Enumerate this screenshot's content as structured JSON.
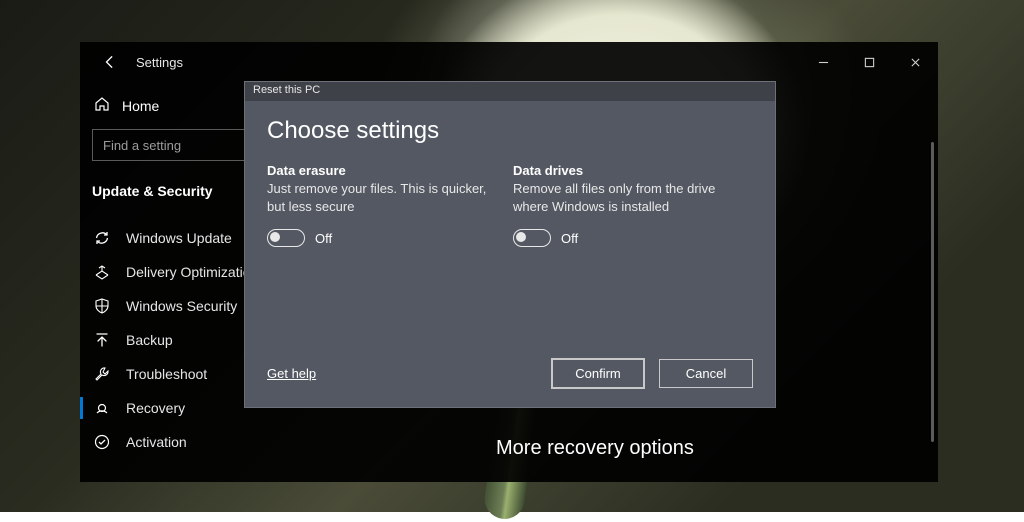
{
  "window": {
    "title": "Settings"
  },
  "sidebar": {
    "home": "Home",
    "search_placeholder": "Find a setting",
    "section_heading": "Update & Security",
    "items": [
      {
        "label": "Windows Update"
      },
      {
        "label": "Delivery Optimization"
      },
      {
        "label": "Windows Security"
      },
      {
        "label": "Backup"
      },
      {
        "label": "Troubleshoot"
      },
      {
        "label": "Recovery"
      },
      {
        "label": "Activation"
      }
    ]
  },
  "main": {
    "more_recovery_heading": "More recovery options"
  },
  "dialog": {
    "title": "Reset this PC",
    "heading": "Choose settings",
    "options": {
      "data_erasure": {
        "title": "Data erasure",
        "description": "Just remove your files. This is quicker, but less secure",
        "state": "Off"
      },
      "data_drives": {
        "title": "Data drives",
        "description": "Remove all files only from the drive where Windows is installed",
        "state": "Off"
      }
    },
    "get_help": "Get help",
    "confirm": "Confirm",
    "cancel": "Cancel"
  }
}
